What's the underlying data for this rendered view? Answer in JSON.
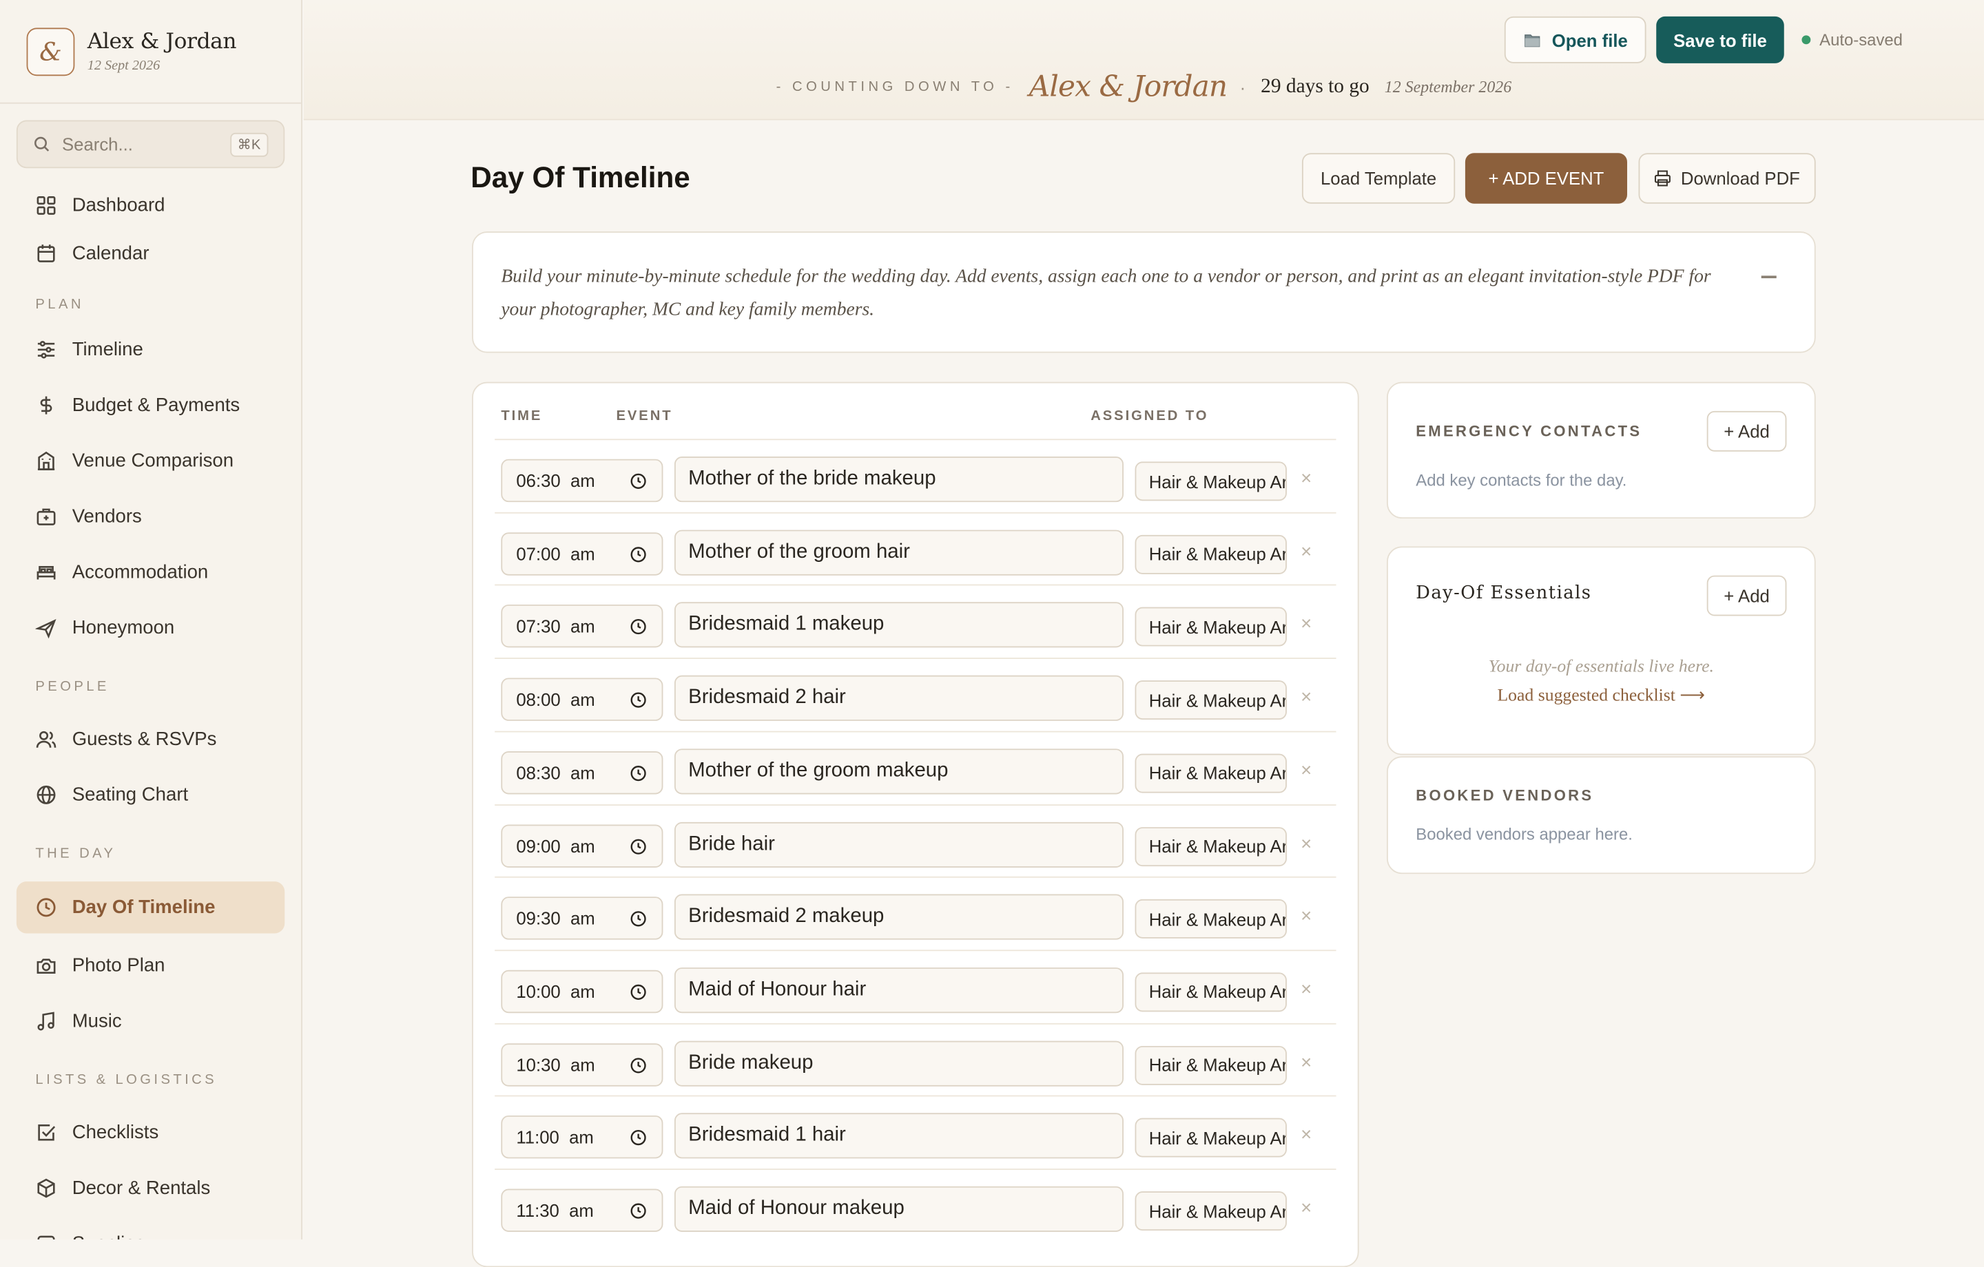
{
  "brand": {
    "monogram": "&",
    "name": "Alex & Jordan",
    "date": "12 Sept 2026"
  },
  "search": {
    "placeholder": "Search...",
    "shortcut": "⌘K"
  },
  "nav": {
    "top": [
      {
        "label": "Dashboard",
        "icon": "grid-icon"
      },
      {
        "label": "Calendar",
        "icon": "calendar-icon"
      }
    ],
    "plan_label": "PLAN",
    "plan": [
      {
        "label": "Timeline",
        "icon": "sliders-icon"
      },
      {
        "label": "Budget & Payments",
        "icon": "dollar-icon"
      },
      {
        "label": "Venue Comparison",
        "icon": "building-icon"
      },
      {
        "label": "Vendors",
        "icon": "briefcase-icon"
      },
      {
        "label": "Accommodation",
        "icon": "bed-icon"
      },
      {
        "label": "Honeymoon",
        "icon": "plane-icon"
      }
    ],
    "people_label": "PEOPLE",
    "people": [
      {
        "label": "Guests & RSVPs",
        "icon": "users-icon"
      },
      {
        "label": "Seating Chart",
        "icon": "globe-icon"
      }
    ],
    "day_label": "THE DAY",
    "day": [
      {
        "label": "Day Of Timeline",
        "icon": "clock-icon",
        "active": true
      },
      {
        "label": "Photo Plan",
        "icon": "camera-icon"
      },
      {
        "label": "Music",
        "icon": "music-icon"
      }
    ],
    "lists_label": "LISTS & LOGISTICS",
    "lists": [
      {
        "label": "Checklists",
        "icon": "check-square-icon"
      },
      {
        "label": "Decor & Rentals",
        "icon": "box-icon"
      },
      {
        "label": "Supplies",
        "icon": "package-icon"
      }
    ]
  },
  "topbar": {
    "open_file": "Open file",
    "save_file": "Save to file",
    "autosave": "Auto-saved",
    "countdown_label": "- COUNTING DOWN TO -",
    "countdown_names": "Alex & Jordan",
    "separator": "·",
    "days_to_go": "29 days to go",
    "wedding_date": "12 September 2026"
  },
  "page": {
    "title": "Day Of Timeline",
    "load_template": "Load Template",
    "add_event": "+ ADD EVENT",
    "download_pdf": "Download PDF",
    "intro": "Build your minute-by-minute schedule for the wedding day. Add events, assign each one to a vendor or person, and print as an elegant invitation-style PDF for your photographer, MC and key family members."
  },
  "timeline": {
    "columns": {
      "time": "TIME",
      "event": "EVENT",
      "assigned": "ASSIGNED TO"
    },
    "rows": [
      {
        "time": "06:30  am",
        "event": "Mother of the bride makeup",
        "assigned": "Hair & Makeup Artist"
      },
      {
        "time": "07:00  am",
        "event": "Mother of the groom hair",
        "assigned": "Hair & Makeup Artist"
      },
      {
        "time": "07:30  am",
        "event": "Bridesmaid 1 makeup",
        "assigned": "Hair & Makeup Artist"
      },
      {
        "time": "08:00  am",
        "event": "Bridesmaid 2 hair",
        "assigned": "Hair & Makeup Artist"
      },
      {
        "time": "08:30  am",
        "event": "Mother of the groom makeup",
        "assigned": "Hair & Makeup Artist"
      },
      {
        "time": "09:00  am",
        "event": "Bride hair",
        "assigned": "Hair & Makeup Artist"
      },
      {
        "time": "09:30  am",
        "event": "Bridesmaid 2 makeup",
        "assigned": "Hair & Makeup Artist"
      },
      {
        "time": "10:00  am",
        "event": "Maid of Honour hair",
        "assigned": "Hair & Makeup Artist"
      },
      {
        "time": "10:30  am",
        "event": "Bride makeup",
        "assigned": "Hair & Makeup Artist"
      },
      {
        "time": "11:00  am",
        "event": "Bridesmaid 1 hair",
        "assigned": "Hair & Makeup Artist"
      },
      {
        "time": "11:30  am",
        "event": "Maid of Honour makeup",
        "assigned": "Hair & Makeup Artist"
      }
    ],
    "remove_glyph": "×"
  },
  "emergency": {
    "title": "EMERGENCY CONTACTS",
    "add": "+ Add",
    "hint": "Add key contacts for the day."
  },
  "essentials": {
    "title": "Day-Of Essentials",
    "add": "+ Add",
    "empty": "Your day-of essentials live here.",
    "link": "Load suggested checklist ⟶"
  },
  "booked": {
    "title": "BOOKED VENDORS",
    "hint": "Booked vendors appear here."
  },
  "colors": {
    "accent": "#8c603c",
    "teal": "#175c5a",
    "active_bg": "#efdfca"
  }
}
